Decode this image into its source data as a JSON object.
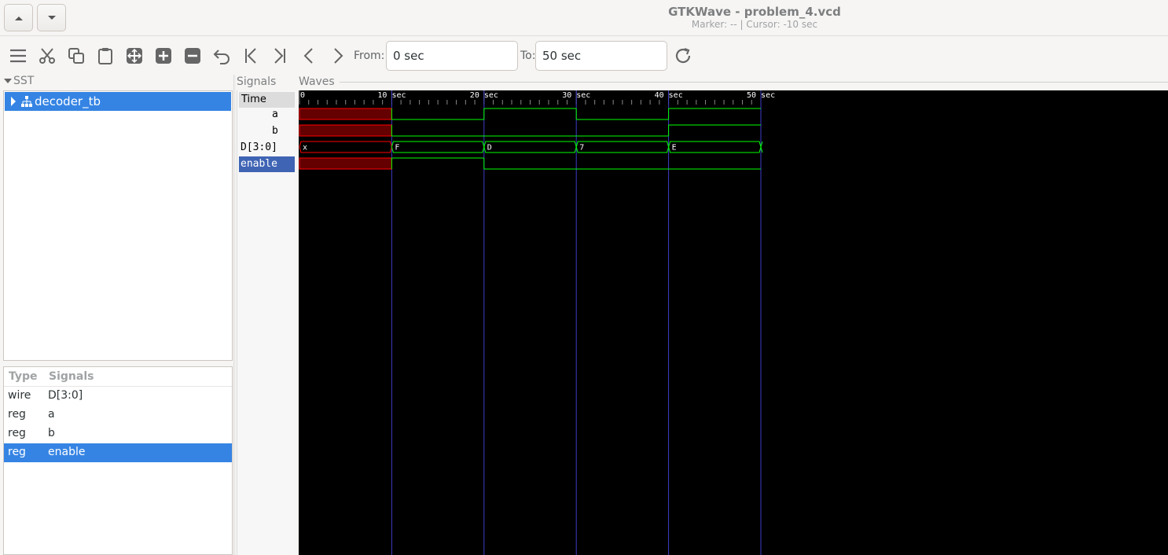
{
  "window": {
    "title": "GTKWave - problem_4.vcd",
    "subtitle": "Marker: --  |  Cursor: -10 sec"
  },
  "toolbar": {
    "from_label": "From:",
    "from_value": "0 sec",
    "to_label": "To:",
    "to_value": "50 sec"
  },
  "sst": {
    "header": "SST",
    "tree": [
      {
        "label": "decoder_tb",
        "selected": true
      }
    ]
  },
  "signal_list": {
    "columns": [
      "Type",
      "Signals"
    ],
    "rows": [
      {
        "type": "wire",
        "name": "D[3:0]",
        "selected": false
      },
      {
        "type": "reg",
        "name": "a",
        "selected": false
      },
      {
        "type": "reg",
        "name": "b",
        "selected": false
      },
      {
        "type": "reg",
        "name": "enable",
        "selected": true
      }
    ]
  },
  "signals_panel": {
    "header": "Signals",
    "time_label": "Time",
    "entries": [
      "a",
      "b",
      "D[3:0]",
      "enable"
    ],
    "selected": "enable"
  },
  "waves": {
    "header": "Waves",
    "time_markers": [
      "0",
      "10 sec",
      "20 sec",
      "30 sec",
      "40 sec",
      "50 sec"
    ],
    "range_start": 0,
    "range_end": 50,
    "signals": [
      {
        "name": "a",
        "kind": "bit",
        "segments": [
          {
            "t0": 0,
            "t1": 10,
            "v": "x"
          },
          {
            "t0": 10,
            "t1": 20,
            "v": "0"
          },
          {
            "t0": 20,
            "t1": 30,
            "v": "1"
          },
          {
            "t0": 30,
            "t1": 40,
            "v": "0"
          },
          {
            "t0": 40,
            "t1": 50,
            "v": "1"
          }
        ]
      },
      {
        "name": "b",
        "kind": "bit",
        "segments": [
          {
            "t0": 0,
            "t1": 10,
            "v": "x"
          },
          {
            "t0": 10,
            "t1": 40,
            "v": "0"
          },
          {
            "t0": 40,
            "t1": 50,
            "v": "1"
          }
        ]
      },
      {
        "name": "D[3:0]",
        "kind": "bus",
        "segments": [
          {
            "t0": 0,
            "t1": 10,
            "v": "x"
          },
          {
            "t0": 10,
            "t1": 20,
            "v": "F"
          },
          {
            "t0": 20,
            "t1": 30,
            "v": "D"
          },
          {
            "t0": 30,
            "t1": 40,
            "v": "7"
          },
          {
            "t0": 40,
            "t1": 50,
            "v": "E"
          }
        ]
      },
      {
        "name": "enable",
        "kind": "bit",
        "segments": [
          {
            "t0": 0,
            "t1": 10,
            "v": "x"
          },
          {
            "t0": 10,
            "t1": 20,
            "v": "1"
          },
          {
            "t0": 20,
            "t1": 50,
            "v": "0"
          }
        ]
      }
    ],
    "colors": {
      "trace": "#00ff00",
      "unknown_fill": "#640000",
      "unknown_edge": "#ff0000",
      "grid": "#3c3cc8",
      "marker_text": "#ffffff",
      "background": "#000000"
    }
  }
}
